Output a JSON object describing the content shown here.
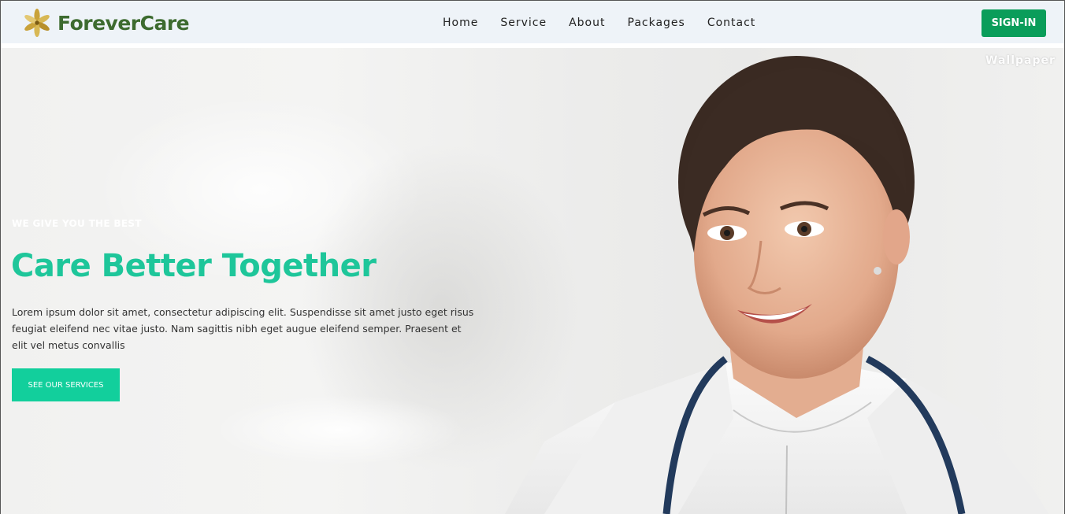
{
  "brand": {
    "name": "ForeverCare",
    "icon": "flower-logo-icon"
  },
  "nav": {
    "links": [
      "Home",
      "Service",
      "About",
      "Packages",
      "Contact"
    ],
    "signin_label": "SIGN-IN"
  },
  "hero": {
    "watermark": "Wallpaper",
    "eyebrow": "WE GIVE YOU THE BEST",
    "headline": "Care Better Together",
    "description": "Lorem ipsum dolor sit amet, consectetur adipiscing elit. Suspendisse sit amet justo eget risus feugiat eleifend nec vitae justo. Nam sagittis nibh eget augue eleifend semper. Praesent et elit vel metus convallis",
    "cta_label": "SEE OUR SERVICES",
    "image": "smiling-doctor-photo"
  },
  "colors": {
    "brand_green": "#3d6b2f",
    "signin_green": "#0a9d5a",
    "accent_teal": "#1ec69a",
    "cta_teal": "#12cf9c",
    "nav_bg": "#eef3f8"
  }
}
